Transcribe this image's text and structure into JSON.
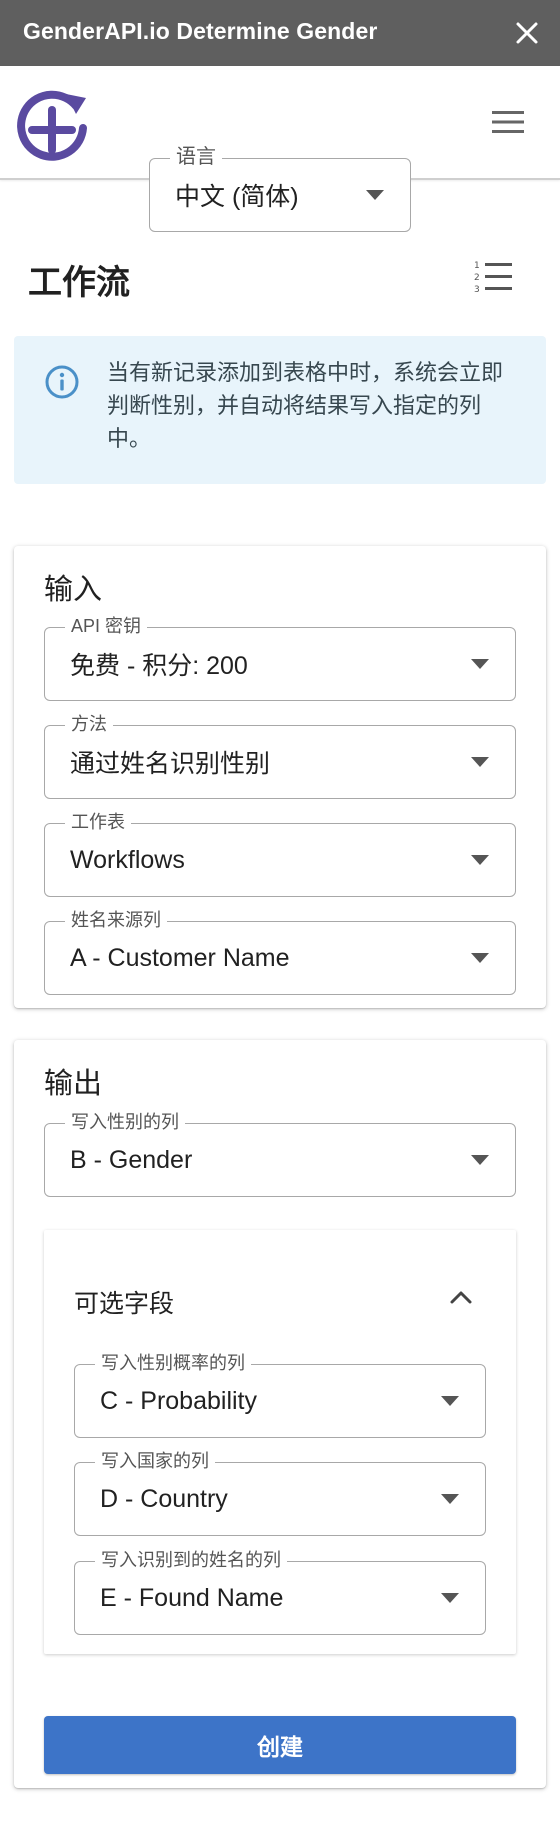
{
  "window": {
    "title": "GenderAPI.io Determine Gender"
  },
  "header": {
    "language": {
      "label": "语言",
      "value": "中文 (简体)"
    }
  },
  "workflow": {
    "title": "工作流",
    "info_text": "当有新记录添加到表格中时，系统会立即判断性别，并自动将结果写入指定的列中。"
  },
  "input_card": {
    "title": "输入",
    "api_key": {
      "label": "API 密钥",
      "value": "免费 - 积分: 200"
    },
    "method": {
      "label": "方法",
      "value": "通过姓名识别性别"
    },
    "sheet": {
      "label": "工作表",
      "value": "Workflows"
    },
    "name_column": {
      "label": "姓名来源列",
      "value": "A - Customer Name"
    }
  },
  "output_card": {
    "title": "输出",
    "gender_column": {
      "label": "写入性别的列",
      "value": "B - Gender"
    },
    "optional": {
      "title": "可选字段",
      "probability_column": {
        "label": "写入性别概率的列",
        "value": "C - Probability"
      },
      "country_column": {
        "label": "写入国家的列",
        "value": "D - Country"
      },
      "found_name_column": {
        "label": "写入识别到的姓名的列",
        "value": "E - Found Name"
      }
    },
    "create_button": "创建"
  },
  "colors": {
    "titlebar": "#5f5f5f",
    "brand_logo": "#5a4aa0",
    "info_background": "#e8f4fb",
    "info_icon": "#4a90c8",
    "primary_button": "#3d74c8"
  },
  "icons": {
    "close": "close-icon",
    "logo": "genderapi-logo",
    "menu": "hamburger-menu-icon",
    "list": "numbered-list-icon",
    "info": "info-icon",
    "dropdown": "caret-down-icon",
    "collapse": "chevron-up-icon"
  }
}
